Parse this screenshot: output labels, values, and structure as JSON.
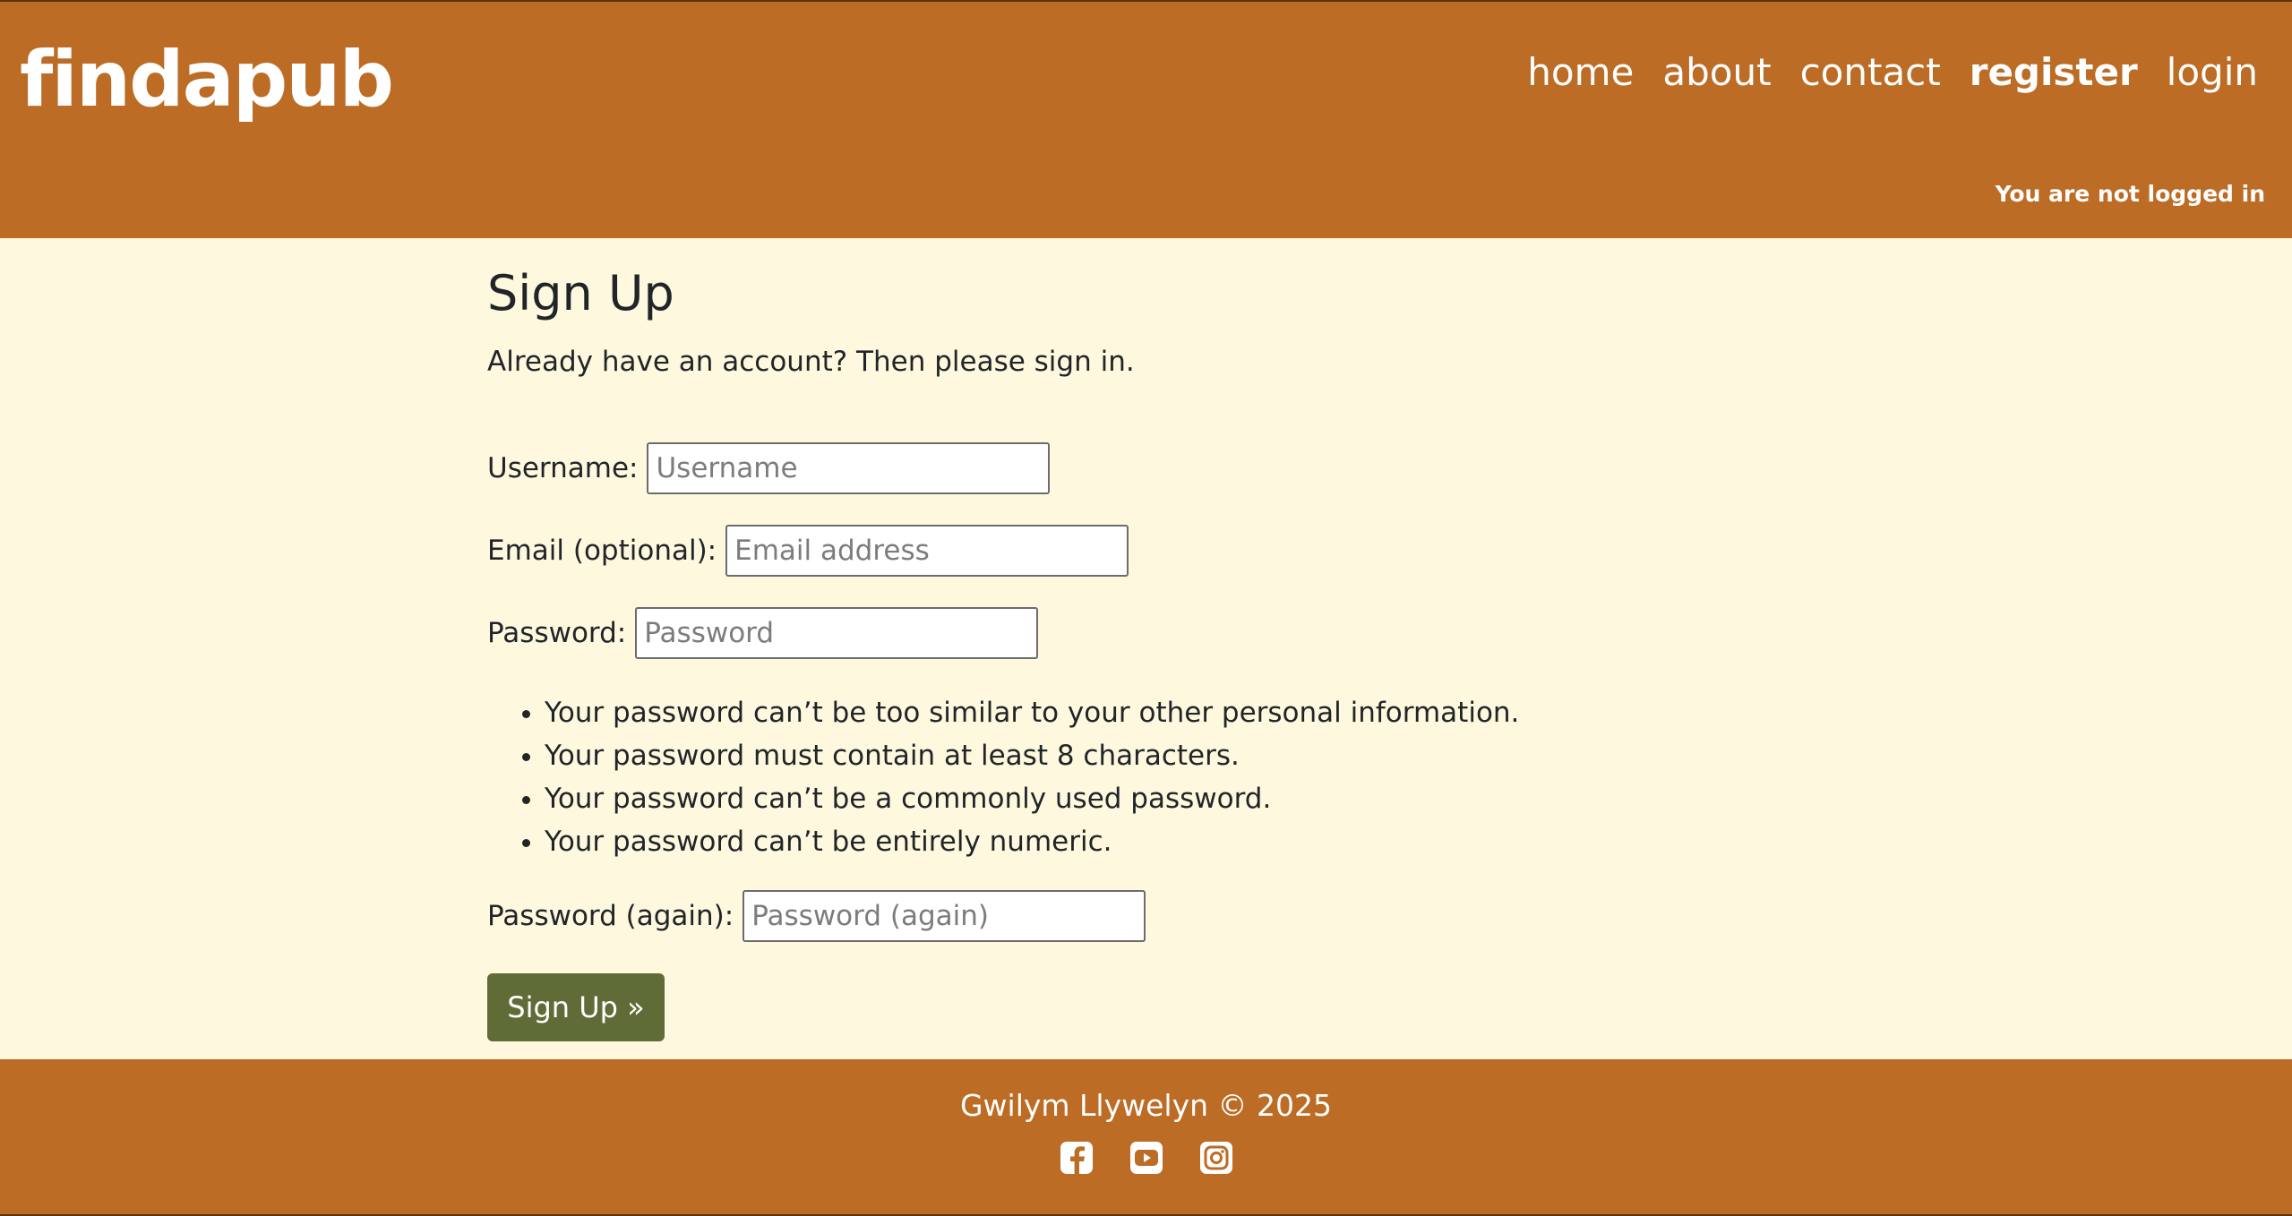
{
  "header": {
    "brand": "findapub",
    "nav": {
      "home": "home",
      "about": "about",
      "contact": "contact",
      "register": "register",
      "login": "login"
    },
    "status": "You are not logged in"
  },
  "main": {
    "title": "Sign Up",
    "intro_text": "Already have an account? Then please ",
    "intro_link": "sign in",
    "intro_end": ".",
    "fields": {
      "username": {
        "label": "Username:",
        "placeholder": "Username"
      },
      "email": {
        "label": "Email (optional):",
        "placeholder": "Email address"
      },
      "password": {
        "label": "Password:",
        "placeholder": "Password"
      },
      "password2": {
        "label": "Password (again):",
        "placeholder": "Password (again)"
      }
    },
    "help": [
      "Your password can’t be too similar to your other personal information.",
      "Your password must contain at least 8 characters.",
      "Your password can’t be a commonly used password.",
      "Your password can’t be entirely numeric."
    ],
    "submit_label": "Sign Up »"
  },
  "footer": {
    "copyright": "Gwilym Llywelyn © 2025",
    "social_icons": [
      "facebook-icon",
      "youtube-icon",
      "instagram-icon"
    ]
  },
  "colors": {
    "header_bg": "#bc6c25",
    "page_bg": "#fef9de",
    "button_bg": "#606c38"
  }
}
